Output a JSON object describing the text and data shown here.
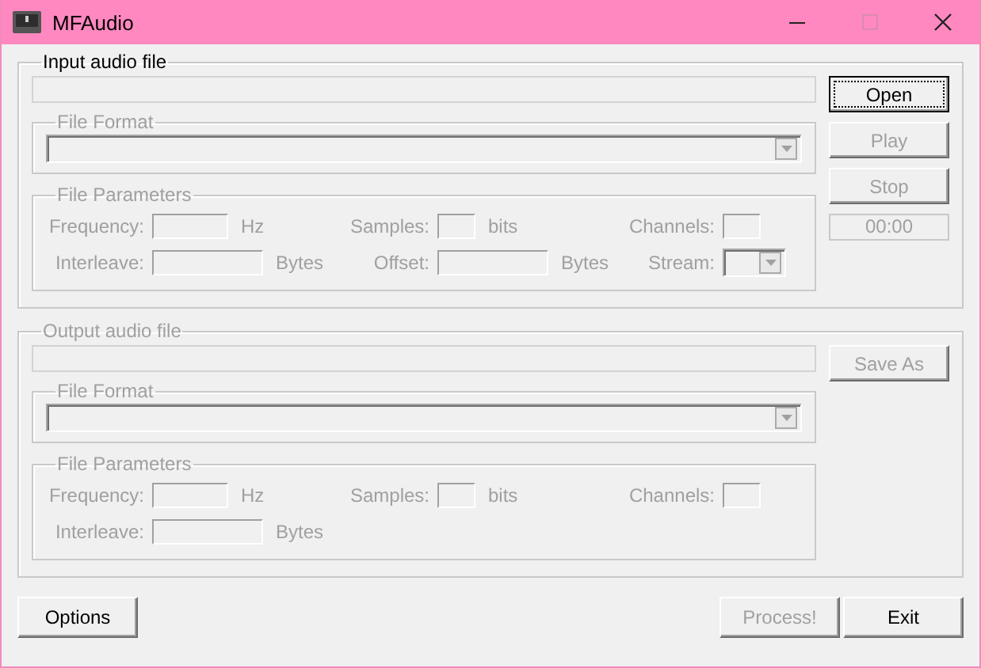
{
  "window": {
    "title": "MFAudio"
  },
  "input": {
    "legend": "Input audio file",
    "disabled": false,
    "file_format": {
      "legend": "File Format",
      "disabled": true
    },
    "parameters": {
      "legend": "File Parameters",
      "disabled": true,
      "rows": [
        [
          {
            "label": "Frequency:",
            "kind": "text",
            "unit": "Hz"
          },
          {
            "label": "Samples:",
            "kind": "text",
            "unit": "bits"
          },
          {
            "label": "Channels:",
            "kind": "text"
          }
        ],
        [
          {
            "label": "Interleave:",
            "kind": "text",
            "unit": "Bytes"
          },
          {
            "label": "Offset:",
            "kind": "text",
            "unit": "Bytes"
          },
          {
            "label": "Stream:",
            "kind": "combo"
          }
        ]
      ]
    },
    "buttons": [
      {
        "label": "Open",
        "disabled": false,
        "focused": true
      },
      {
        "label": "Play",
        "disabled": true,
        "focused": false
      },
      {
        "label": "Stop",
        "disabled": true,
        "focused": false
      }
    ],
    "time": {
      "value": "00:00",
      "disabled": true
    }
  },
  "output": {
    "legend": "Output audio file",
    "disabled": true,
    "file_format": {
      "legend": "File Format",
      "disabled": true
    },
    "parameters": {
      "legend": "File Parameters",
      "disabled": true,
      "rows": [
        [
          {
            "label": "Frequency:",
            "kind": "text",
            "unit": "Hz"
          },
          {
            "label": "Samples:",
            "kind": "text",
            "unit": "bits"
          },
          {
            "label": "Channels:",
            "kind": "text"
          }
        ],
        [
          {
            "label": "Interleave:",
            "kind": "text",
            "unit": "Bytes"
          }
        ]
      ]
    },
    "buttons": [
      {
        "label": "Save As",
        "disabled": true,
        "focused": false
      }
    ]
  },
  "footer": {
    "left_buttons": [
      {
        "label": "Options",
        "disabled": false,
        "focused": false
      }
    ],
    "right_buttons": [
      {
        "label": "Process!",
        "disabled": true,
        "focused": false
      },
      {
        "label": "Exit",
        "disabled": false,
        "focused": false
      }
    ]
  }
}
